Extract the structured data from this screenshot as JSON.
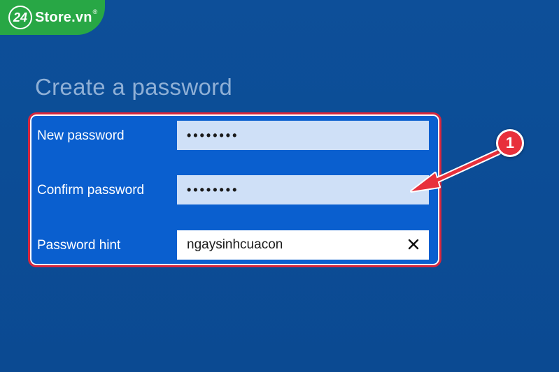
{
  "brand": {
    "badge": "24",
    "name": "Store.vn",
    "mark": "®"
  },
  "title": "Create a password",
  "form": {
    "new_password": {
      "label": "New password",
      "value": "••••••••"
    },
    "confirm_password": {
      "label": "Confirm password",
      "value": "••••••••"
    },
    "password_hint": {
      "label": "Password hint",
      "value": "ngaysinhcuacon"
    }
  },
  "annotation": {
    "step": "1"
  },
  "colors": {
    "background": "#0c4d97",
    "panel": "#0a5fcf",
    "highlight_border": "#d7263d",
    "brand_green": "#28a745",
    "callout_red": "#e8303b",
    "title": "#8fb0d6"
  },
  "icons": {
    "clear": "close-icon",
    "arrow": "arrow-icon"
  }
}
